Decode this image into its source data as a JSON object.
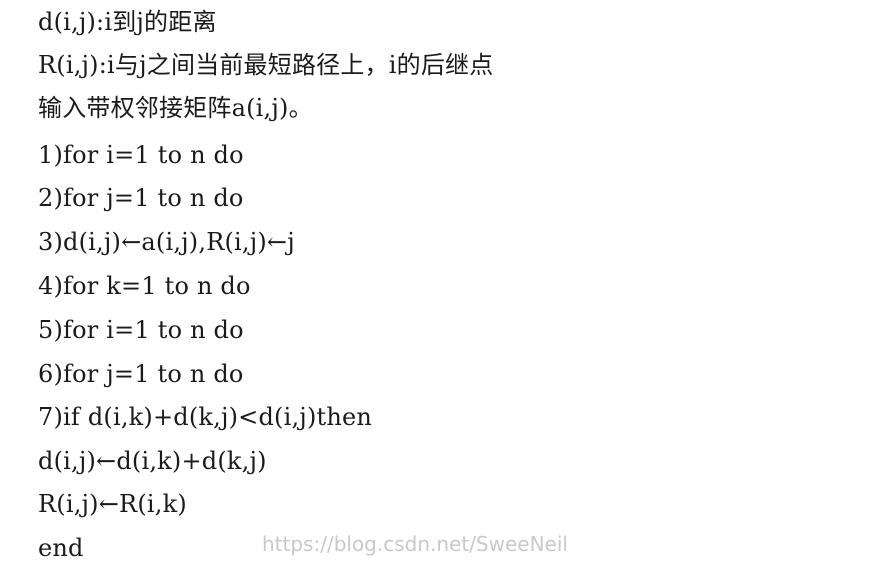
{
  "lines": [
    "d(i,j):i到j的距离",
    "R(i,j):i与j之间当前最短路径上，i的后继点",
    "输入带权邻接矩阵a(i,j)。",
    "1)for i=1 to n do",
    "2)for j=1 to n do",
    "3)d(i,j)←a(i,j),R(i,j)←j",
    "4)for k=1 to n do",
    "5)for i=1 to n do",
    "6)for j=1 to n do",
    "7)if d(i,k)+d(k,j)<d(i,j)then",
    "d(i,j)←d(i,k)+d(k,j)",
    "R(i,j)←R(i,k)",
    "end"
  ],
  "watermark": "https://blog.csdn.net/SweeNeil"
}
